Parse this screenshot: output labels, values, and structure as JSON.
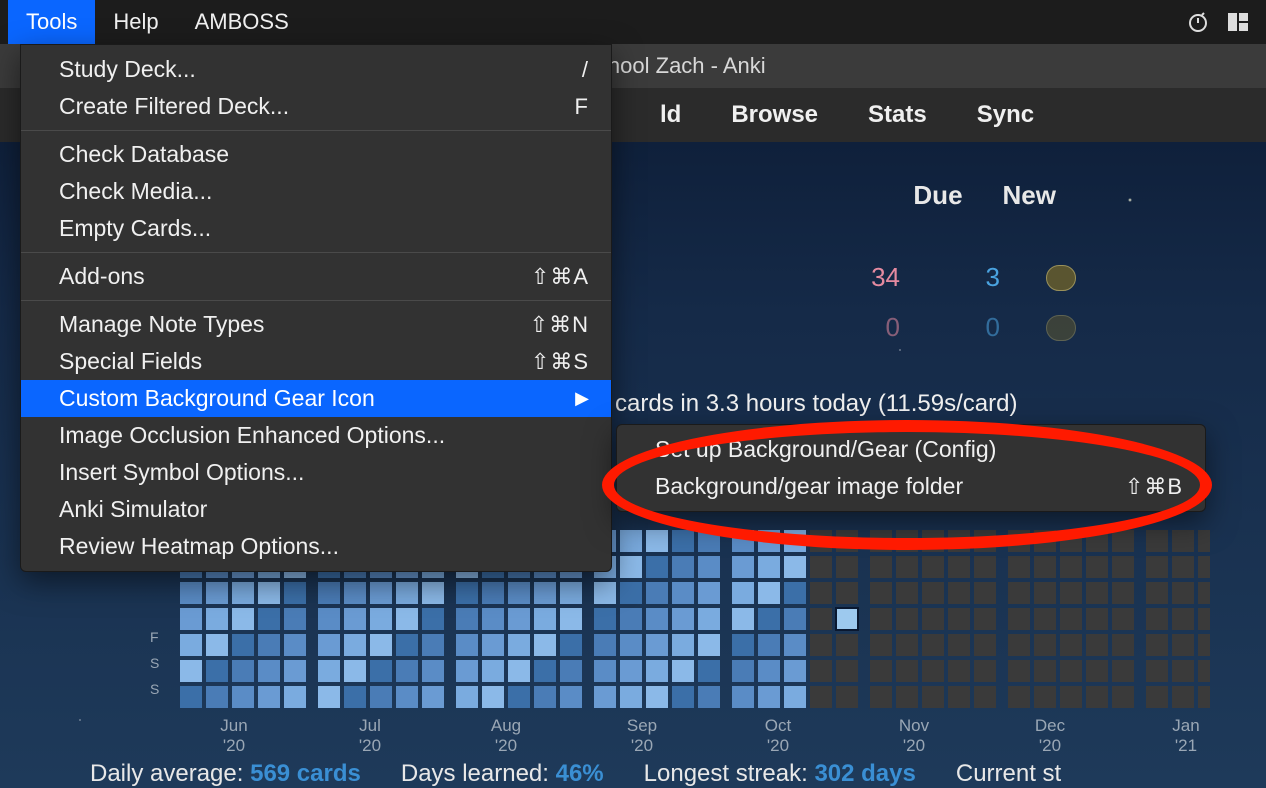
{
  "menubar": {
    "tools": "Tools",
    "help": "Help",
    "amboss": "AMBOSS"
  },
  "window_title": "Medical School Zach - Anki",
  "toolbar": {
    "add": "ld",
    "browse": "Browse",
    "stats": "Stats",
    "sync": "Sync"
  },
  "deck_headers": {
    "due": "Due",
    "new": "New"
  },
  "deck_rows": [
    {
      "due": "34",
      "new": "3"
    },
    {
      "due": "0",
      "new": "0"
    }
  ],
  "studied_line": "cards in 3.3 hours today (11.59s/card)",
  "tools_menu": {
    "study_deck": {
      "label": "Study Deck...",
      "shortcut": "/"
    },
    "create_filtered": {
      "label": "Create Filtered Deck...",
      "shortcut": "F"
    },
    "check_db": {
      "label": "Check Database"
    },
    "check_media": {
      "label": "Check Media..."
    },
    "empty_cards": {
      "label": "Empty Cards..."
    },
    "addons": {
      "label": "Add-ons",
      "shortcut": "⇧⌘A"
    },
    "manage_notes": {
      "label": "Manage Note Types",
      "shortcut": "⇧⌘N"
    },
    "special_fields": {
      "label": "Special Fields",
      "shortcut": "⇧⌘S"
    },
    "custom_bg": {
      "label": "Custom Background  Gear Icon"
    },
    "image_occlusion": {
      "label": "Image Occlusion Enhanced Options..."
    },
    "insert_symbol": {
      "label": "Insert Symbol Options..."
    },
    "anki_simulator": {
      "label": "Anki Simulator"
    },
    "review_heatmap": {
      "label": "Review Heatmap Options..."
    }
  },
  "submenu": {
    "config": {
      "label": "Set up Background/Gear (Config)"
    },
    "image_folder": {
      "label": "Background/gear image folder",
      "shortcut": "⇧⌘B"
    }
  },
  "heatmap": {
    "months": [
      "Jun '20",
      "Jul '20",
      "Aug '20",
      "Sep '20",
      "Oct '20",
      "Nov '20",
      "Dec '20",
      "Jan '21"
    ],
    "day_labels": [
      "F",
      "S",
      "S"
    ]
  },
  "stats": {
    "daily_avg_label": "Daily average:",
    "daily_avg_value": "569 cards",
    "days_learned_label": "Days learned:",
    "days_learned_value": "46%",
    "longest_streak_label": "Longest streak:",
    "longest_streak_value": "302 days",
    "current_label": "Current st"
  }
}
